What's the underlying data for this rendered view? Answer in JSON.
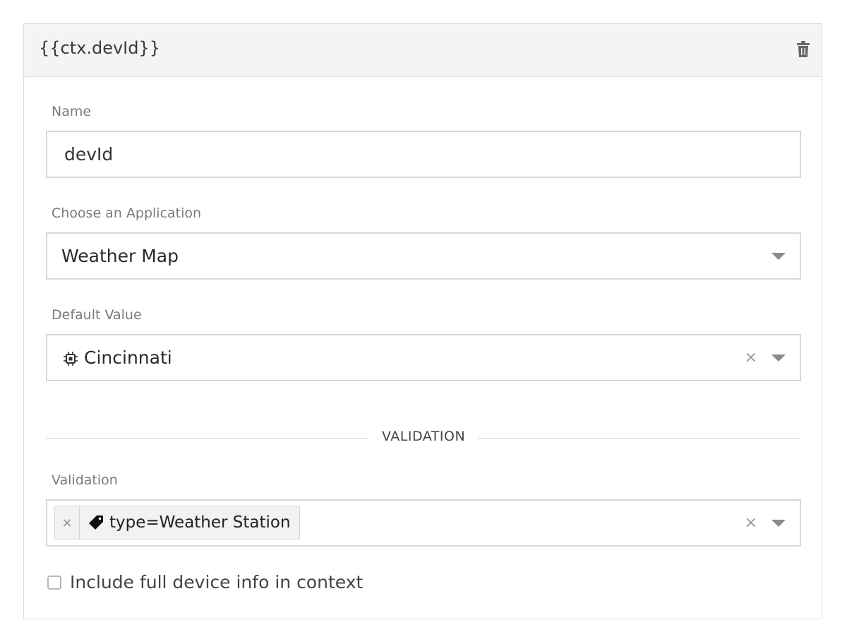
{
  "header": {
    "title": "{{ctx.devId}}",
    "delete_icon": "trash-icon"
  },
  "name_field": {
    "label": "Name",
    "value": "devId"
  },
  "application_field": {
    "label": "Choose an Application",
    "selected": "Weather Map"
  },
  "default_value_field": {
    "label": "Default Value",
    "icon": "device-chip-icon",
    "selected": "Cincinnati",
    "clear_symbol": "×"
  },
  "validation_section": {
    "divider_title": "VALIDATION",
    "label": "Validation",
    "tag": {
      "remove_symbol": "×",
      "icon": "tag-icon",
      "text": "type=Weather Station"
    },
    "clear_symbol": "×"
  },
  "checkbox": {
    "label": "Include full device info in context",
    "checked": false
  }
}
